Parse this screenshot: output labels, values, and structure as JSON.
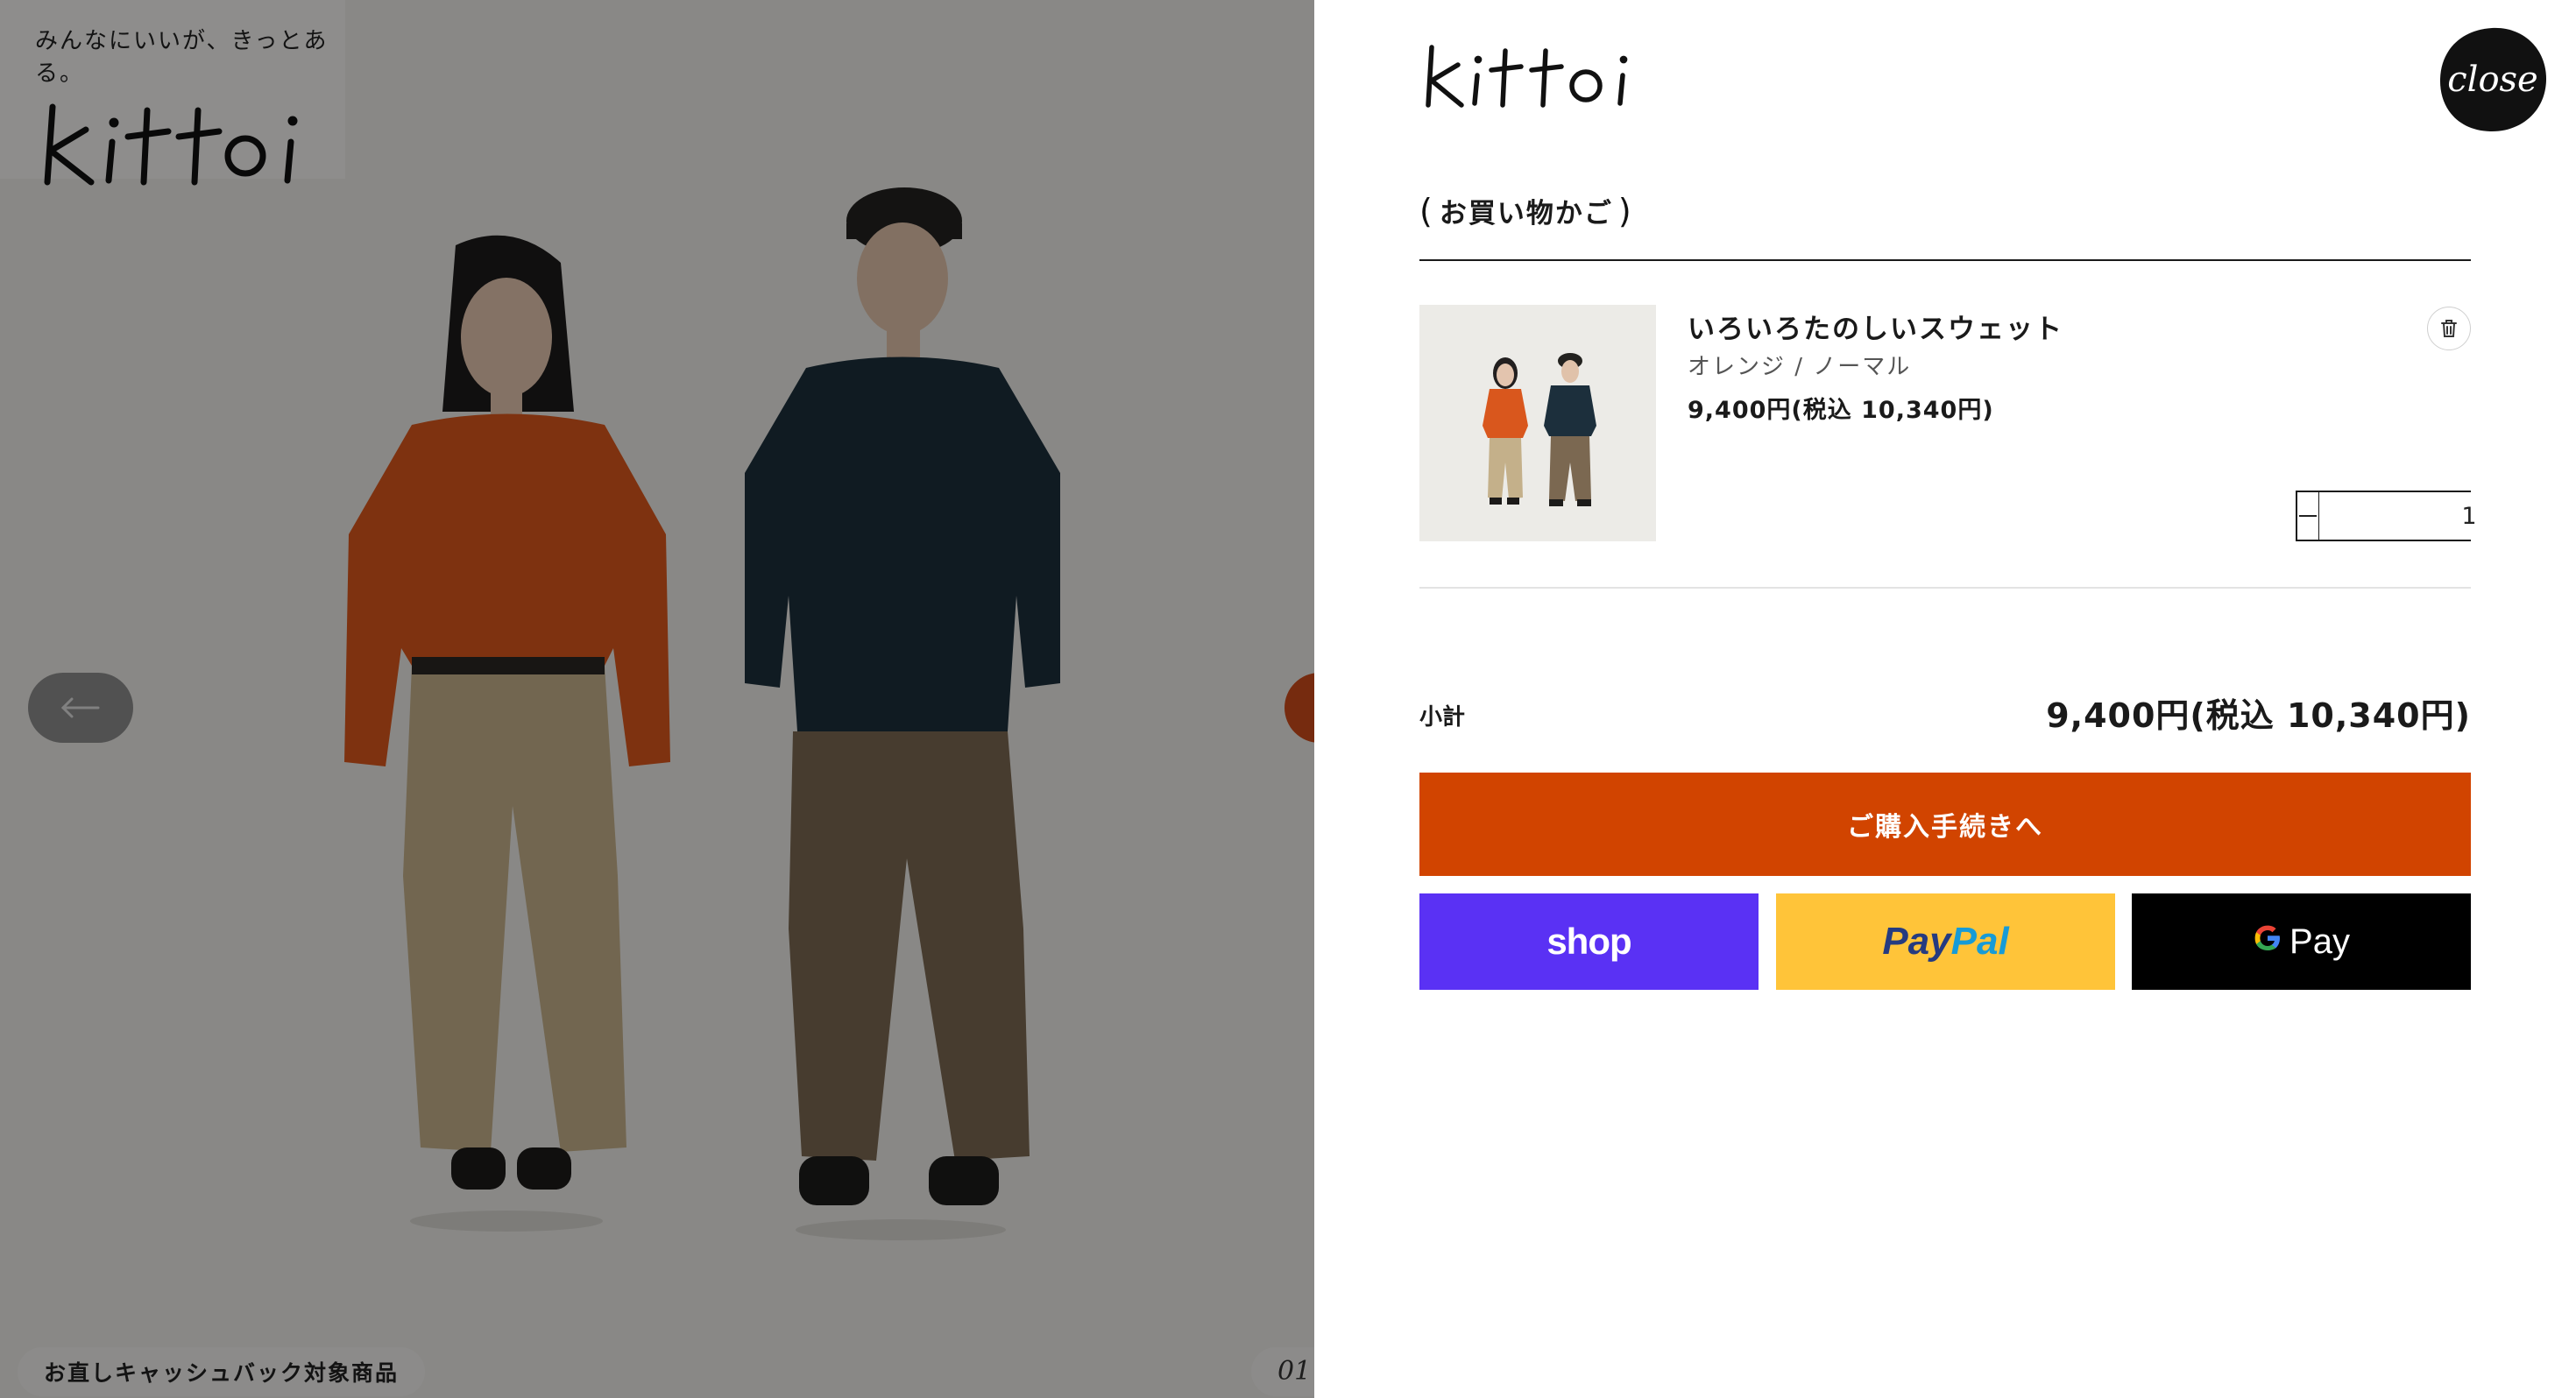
{
  "product_page": {
    "tagline": "みんなにいいが、きっとある。",
    "logo_text": "kittoi",
    "badge": "お直しキャッシュバック対象商品",
    "slide_counter": "01",
    "prev_icon": "arrow-left-icon",
    "overlay_color": "#000000"
  },
  "drawer": {
    "logo_text": "kittoi",
    "close_label": "close",
    "cart_title": "お買い物かご",
    "cart_title_open": "(",
    "cart_title_close": ")",
    "items": [
      {
        "name": "いろいろたのしいスウェット",
        "variant": "オレンジ / ノーマル",
        "price": "9,400円(税込 10,340円)",
        "quantity": "1"
      }
    ],
    "subtotal_label": "小計",
    "subtotal_value": "9,400円(税込 10,340円)",
    "checkout_label": "ご購入手続きへ",
    "pay_shop_label": "shop",
    "pay_paypal_part1": "Pay",
    "pay_paypal_part2": "Pal",
    "pay_gpay_label": "Pay",
    "pay_gpay_g": "G"
  },
  "colors": {
    "accent": "#d14400",
    "shop_pay": "#5a31f4",
    "paypal": "#ffc439",
    "gpay": "#000000"
  }
}
